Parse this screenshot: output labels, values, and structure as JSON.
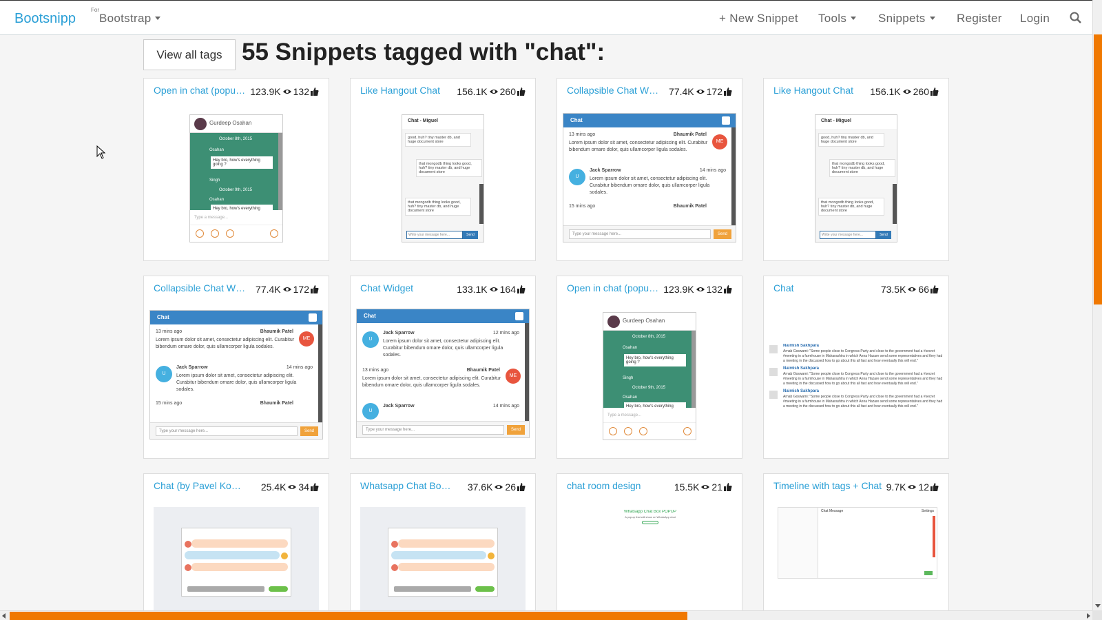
{
  "nav": {
    "brand": "Bootsnipp",
    "for_label": "For",
    "framework": "Bootstrap",
    "new_snippet": "+ New Snippet",
    "tools": "Tools",
    "snippets": "Snippets",
    "register": "Register",
    "login": "Login"
  },
  "header": {
    "view_all_tags": "View all tags",
    "title": "55 Snippets tagged with \"chat\":"
  },
  "cards": [
    {
      "title": "Open in chat (popup...",
      "views": "123.9K",
      "likes": "132"
    },
    {
      "title": "Like Hangout Chat",
      "views": "156.1K",
      "likes": "260"
    },
    {
      "title": "Collapsible Chat Wid...",
      "views": "77.4K",
      "likes": "172"
    },
    {
      "title": "Like Hangout Chat",
      "views": "156.1K",
      "likes": "260"
    },
    {
      "title": "Collapsible Chat Wid...",
      "views": "77.4K",
      "likes": "172"
    },
    {
      "title": "Chat Widget",
      "views": "133.1K",
      "likes": "164"
    },
    {
      "title": "Open in chat (popup...",
      "views": "123.9K",
      "likes": "132"
    },
    {
      "title": "Chat",
      "views": "73.5K",
      "likes": "66"
    },
    {
      "title": "Chat (by Pavel Komiag...",
      "views": "25.4K",
      "likes": "34"
    },
    {
      "title": "Whatsapp Chat Box P...",
      "views": "37.6K",
      "likes": "26"
    },
    {
      "title": "chat room design",
      "views": "15.5K",
      "likes": "21"
    },
    {
      "title": "Timeline with tags + Chat",
      "views": "9.7K",
      "likes": "12"
    }
  ],
  "previews": {
    "gurdeep": {
      "name": "Gurdeep Osahan",
      "date1": "October 8th, 2015",
      "user1": "Osahan",
      "msg1": "Hey bro, how's everything going ?",
      "user2": "Singh",
      "date2": "October 9th, 2015",
      "user3": "Osahan",
      "msg3": "Hey bro, how's everything",
      "input": "Type a message..."
    },
    "hangout": {
      "header": "Chat - Miguel",
      "msg1": "good, huh? tiny master db, and huge document store",
      "msg2": "that mongodb thing looks good, huh? tiny master db, and huge document store",
      "msg3": "that mongodb thing looks good, huh? tiny master db, and huge document store",
      "input": "Write your message here...",
      "send": "Send"
    },
    "collapsible": {
      "header": "Chat",
      "t1": "13 mins ago",
      "n1": "Bhaumik Patel",
      "lorem": "Lorem ipsum dolor sit amet, consectetur adipiscing elit. Curabitur bibendum ornare dolor, quis ullamcorper ligula sodales.",
      "n2": "Jack Sparrow",
      "t2": "14 mins ago",
      "t3": "15 mins ago",
      "me": "ME",
      "u": "U",
      "input": "Type your message here...",
      "send": "Send"
    },
    "widget": {
      "header": "Chat",
      "n1": "Jack Sparrow",
      "t1": "12 mins ago",
      "t2": "13 mins ago",
      "n2": "Bhaumik Patel",
      "t3": "14 mins ago"
    },
    "comments": {
      "name": "Naimish Sakhpara",
      "text": "Arnab Goswami: \"Some people close to Congress Party and close to the government had a #secret #meeting in a farmhouse in Maharashtra in which Anna Hazare send some representatives and they had a meeting in the discussed how to go about this all fast and how eventually this will end.\""
    },
    "room": {
      "title": "Whatsapp Chat Box POPUP",
      "line": "A popup that will show on WhatsApp chat"
    },
    "timeline": {
      "header": "Chat Message",
      "label": "Settings"
    }
  },
  "colors": {
    "brand": "#2a9fd6",
    "scroll_thumb": "#f07800",
    "chat_blue": "#3a85c6",
    "chat_green": "#3d8f74",
    "me_badge": "#e8553e",
    "user_badge": "#45b0e0"
  }
}
